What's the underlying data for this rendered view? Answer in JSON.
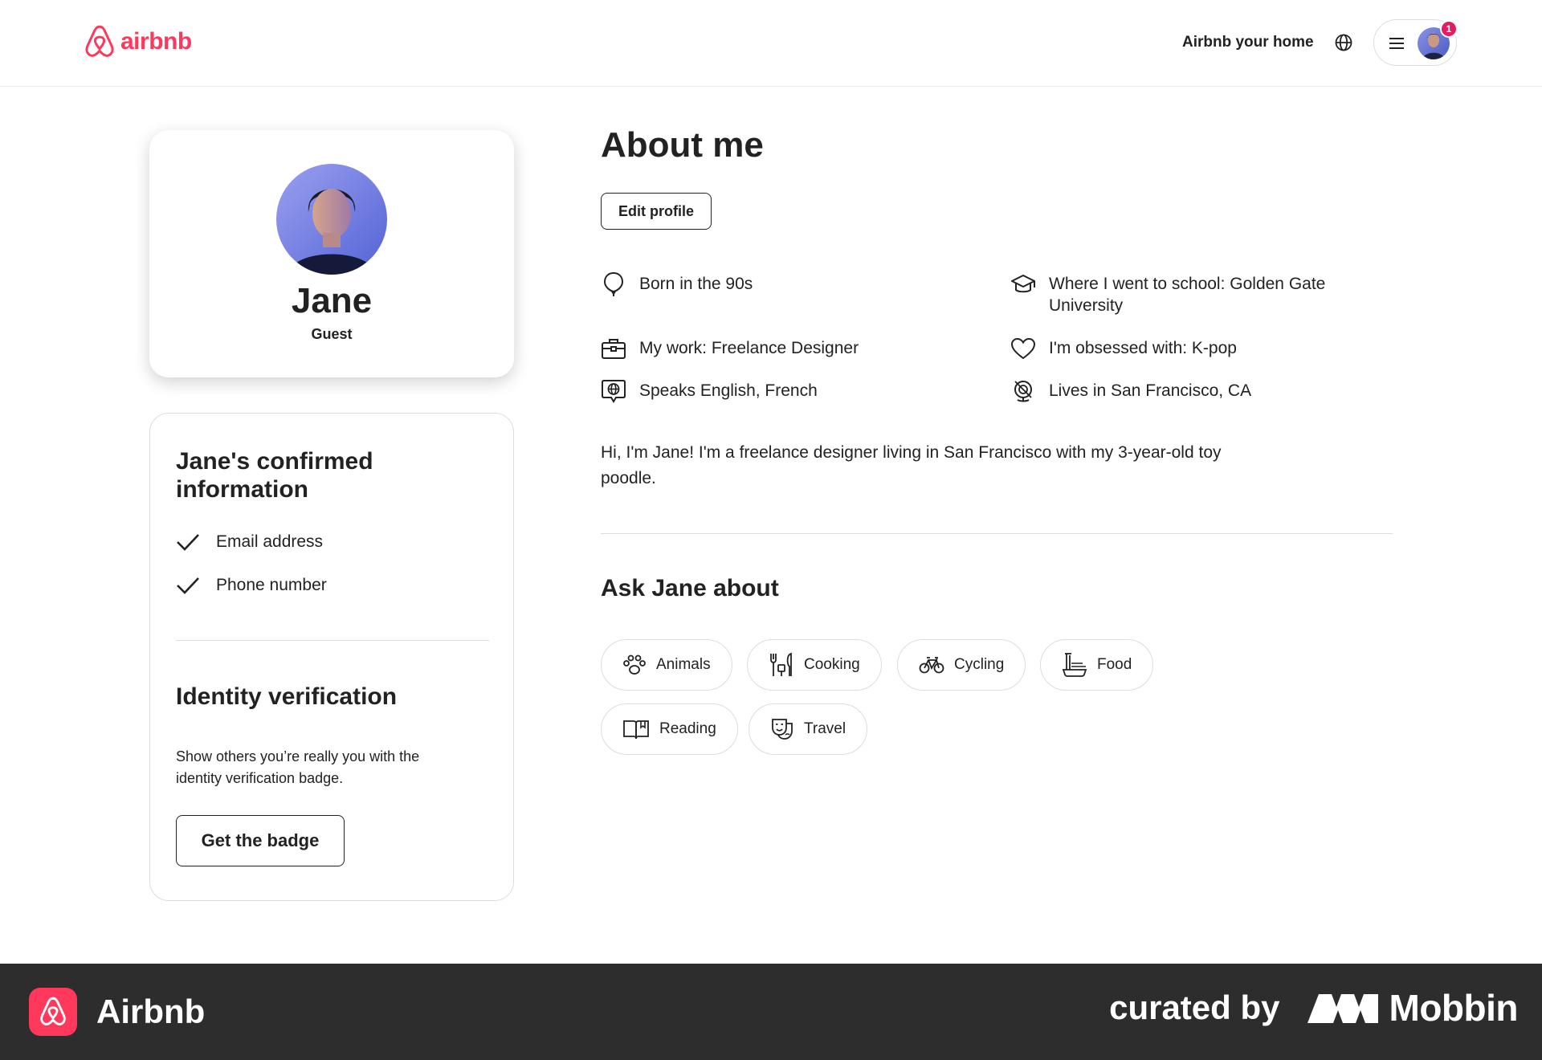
{
  "header": {
    "logo_text": "airbnb",
    "host_link": "Airbnb your home",
    "notification_count": "1"
  },
  "profile": {
    "name": "Jane",
    "role": "Guest"
  },
  "confirmed": {
    "title": "Jane's confirmed information",
    "items": [
      "Email address",
      "Phone number"
    ]
  },
  "identity": {
    "title": "Identity verification",
    "description": "Show others you’re really you with the identity verification badge.",
    "button_label": "Get the badge"
  },
  "about": {
    "title": "About me",
    "edit_label": "Edit profile",
    "facts": [
      {
        "icon": "balloon-icon",
        "text": "Born in the 90s"
      },
      {
        "icon": "graduation-cap-icon",
        "text": "Where I went to school: Golden Gate University"
      },
      {
        "icon": "briefcase-icon",
        "text": "My work: Freelance Designer"
      },
      {
        "icon": "heart-icon",
        "text": "I'm obsessed with: K-pop"
      },
      {
        "icon": "speech-globe-icon",
        "text": "Speaks English, French"
      },
      {
        "icon": "location-globe-icon",
        "text": "Lives in San Francisco, CA"
      }
    ],
    "bio": "Hi, I'm Jane! I'm a freelance designer living in San Francisco with my 3-year-old toy poodle."
  },
  "ask": {
    "title": "Ask Jane about",
    "topics": [
      {
        "icon": "paw-icon",
        "label": "Animals"
      },
      {
        "icon": "utensils-icon",
        "label": "Cooking"
      },
      {
        "icon": "bicycle-icon",
        "label": "Cycling"
      },
      {
        "icon": "noodles-icon",
        "label": "Food"
      },
      {
        "icon": "book-icon",
        "label": "Reading"
      },
      {
        "icon": "masks-icon",
        "label": "Travel"
      }
    ]
  },
  "banner": {
    "app_name": "Airbnb",
    "curated_by": "curated by",
    "brand": "Mobbin"
  },
  "colors": {
    "brand": "#ff385c",
    "text": "#222222",
    "border": "#dddddd",
    "banner_bg": "#2d2d2d"
  }
}
